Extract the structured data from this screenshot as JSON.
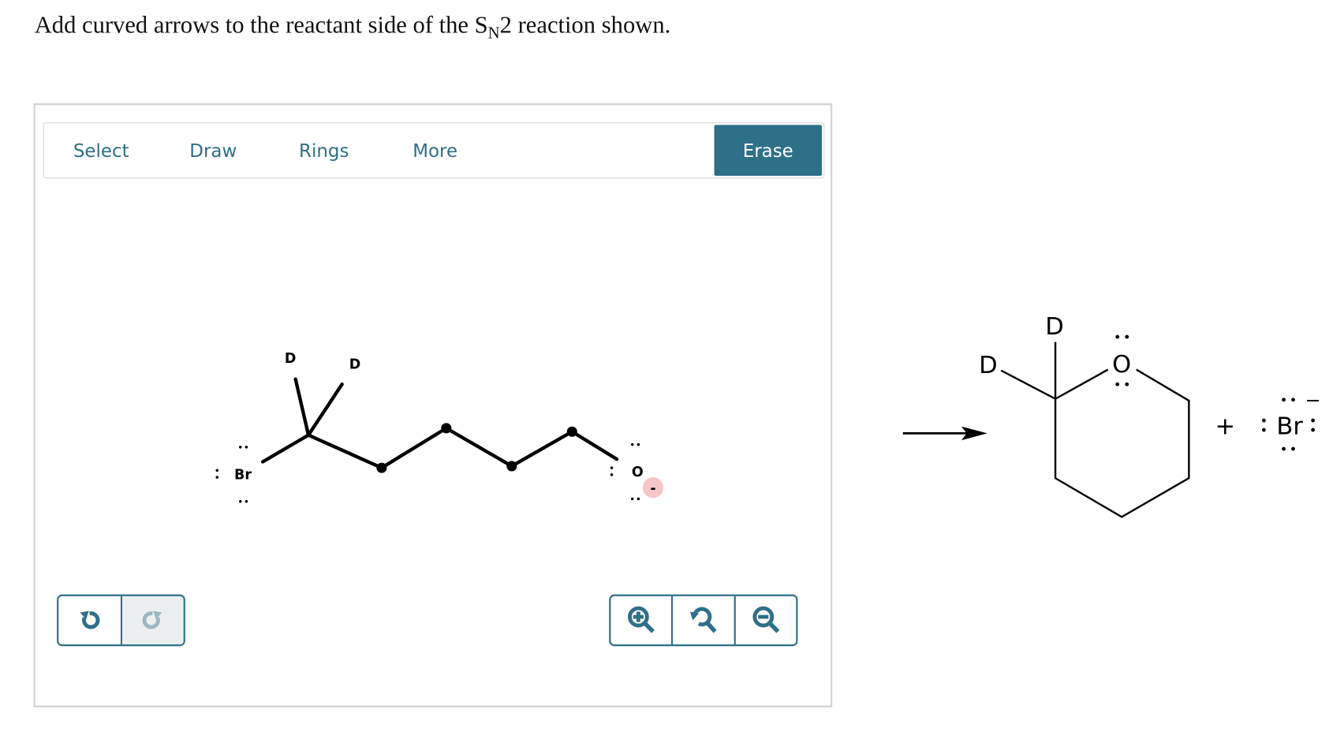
{
  "question": {
    "prefix": "Add curved arrows to the reactant side of the S",
    "subscript": "N",
    "suffix": "2 reaction shown."
  },
  "toolbar": {
    "tabs": [
      {
        "label": "Select"
      },
      {
        "label": "Draw"
      },
      {
        "label": "Rings"
      },
      {
        "label": "More"
      }
    ],
    "erase_label": "Erase"
  },
  "canvas": {
    "reactant": {
      "atoms": {
        "br": "Br",
        "o": "O",
        "d1": "D",
        "d2": "D"
      },
      "charge": "-"
    },
    "history": {
      "undo_icon": "undo-icon",
      "redo_icon": "redo-icon",
      "redo_enabled": false
    },
    "zoom": {
      "zoom_in_icon": "zoom-in-icon",
      "reset_icon": "zoom-reset-icon",
      "zoom_out_icon": "zoom-out-icon"
    }
  },
  "product": {
    "atoms": {
      "d_top": "D",
      "d_left": "D",
      "o": "O",
      "br": "Br"
    },
    "plus": "+",
    "charge": "−"
  },
  "colors": {
    "accent": "#2f7089",
    "charge_bg": "#f6c6c9"
  }
}
